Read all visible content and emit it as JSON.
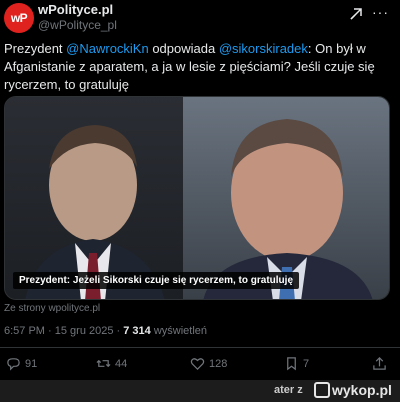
{
  "tweet": {
    "avatar_text": "wP",
    "display_name": "wPolityce.pl",
    "handle": "@wPolityce_pl",
    "text_prefix": "Prezydent ",
    "mention_1": "@NawrockiKn",
    "text_mid": " odpowiada ",
    "mention_2": "@sikorskiradek",
    "text_rest": ": On był w Afganistanie z aparatem, a ja w lesie z pięściami? Jeśli czuje się rycerzem, to gratuluję",
    "media_caption": "Prezydent: Jeżeli Sikorski czuje się rycerzem, to gratuluję",
    "source": "Ze strony wpolityce.pl",
    "time": "6:57 PM · 15 gru 2025 · ",
    "views_count": "7 314",
    "views_label": " wyświetleń"
  },
  "actions": {
    "reply_count": "91",
    "retweet_count": "44",
    "like_count": "128",
    "bookmark_count": "7"
  },
  "footer": {
    "user": "ater z",
    "logo": "wykop.pl"
  },
  "colors": {
    "background": "#000000",
    "accent": "#1d9bf0",
    "brand_red": "#e0221e"
  }
}
